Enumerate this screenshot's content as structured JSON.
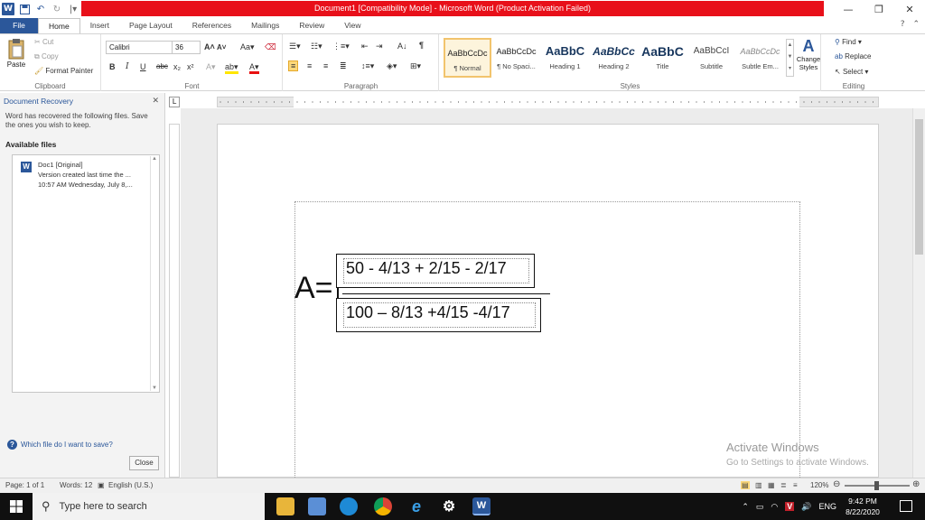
{
  "title_bar": {
    "title": "Document1 [Compatibility Mode] - Microsoft Word (Product Activation Failed)",
    "minimize": "—",
    "maximize": "❐",
    "close": "✕"
  },
  "tabs": [
    {
      "label": "File"
    },
    {
      "label": "Home"
    },
    {
      "label": "Insert"
    },
    {
      "label": "Page Layout"
    },
    {
      "label": "References"
    },
    {
      "label": "Mailings"
    },
    {
      "label": "Review"
    },
    {
      "label": "View"
    }
  ],
  "ribbon": {
    "clipboard": {
      "paste": "Paste",
      "cut": "Cut",
      "copy": "Copy",
      "format_painter": "Format Painter",
      "label": "Clipboard"
    },
    "font": {
      "name": "Calibri",
      "size": "36",
      "label": "Font"
    },
    "paragraph": {
      "label": "Paragraph"
    },
    "styles": {
      "label": "Styles",
      "items": [
        {
          "sample": "AaBbCcDc",
          "name": "¶ Normal"
        },
        {
          "sample": "AaBbCcDc",
          "name": "¶ No Spaci..."
        },
        {
          "sample": "AaBbC",
          "name": "Heading 1"
        },
        {
          "sample": "AaBbCc",
          "name": "Heading 2"
        },
        {
          "sample": "AaBbC",
          "name": "Title"
        },
        {
          "sample": "AaBbCcI",
          "name": "Subtitle"
        },
        {
          "sample": "AaBbCcDc",
          "name": "Subtle Em..."
        }
      ],
      "change_styles": "Change Styles"
    },
    "editing": {
      "find": "Find",
      "replace": "Replace",
      "select": "Select",
      "label": "Editing"
    }
  },
  "recovery_pane": {
    "title": "Document Recovery",
    "description": "Word has recovered the following files.  Save the ones you wish to keep.",
    "available_heading": "Available files",
    "files": [
      {
        "name": "Doc1  [Original]",
        "line2": "Version created last time the ...",
        "line3": "10:57 AM Wednesday, July 8,..."
      }
    ],
    "help_link": "Which file do I want to save?",
    "close_button": "Close"
  },
  "document": {
    "lhs": "A=",
    "numerator": "50 - 4/13 + 2/15 - 2/17",
    "denominator": "100 – 8/13 +4/15 -4/17"
  },
  "watermark": {
    "line1": "Activate Windows",
    "line2": "Go to Settings to activate Windows."
  },
  "status_bar": {
    "page": "Page: 1 of 1",
    "words": "Words: 12",
    "language": "English (U.S.)",
    "zoom": "120%"
  },
  "taskbar": {
    "search_placeholder": "Type here to search",
    "language": "ENG",
    "time": "9:42 PM",
    "date": "8/22/2020"
  }
}
